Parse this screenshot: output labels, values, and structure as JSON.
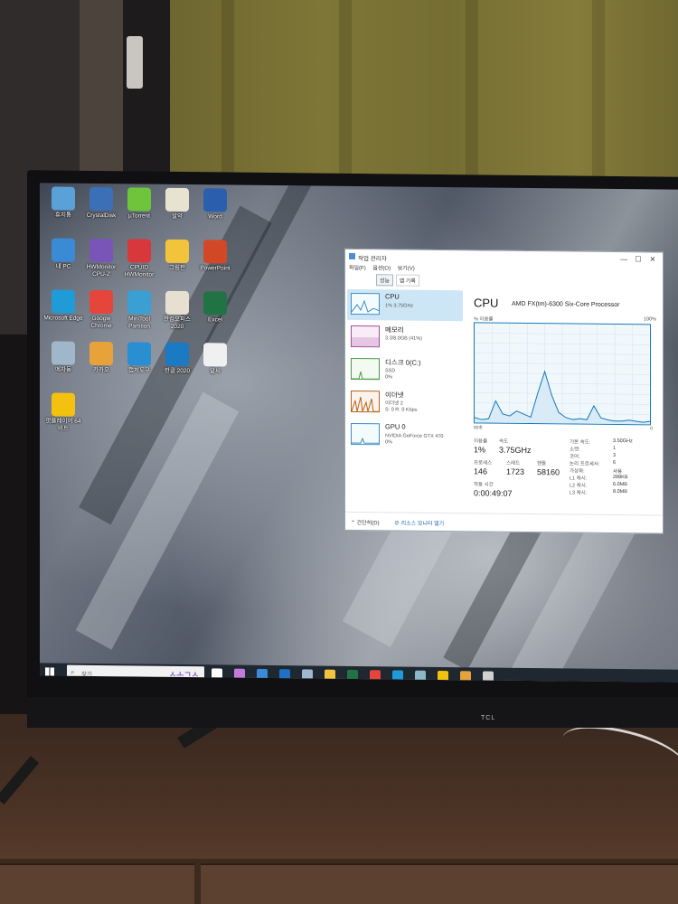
{
  "desktop": {
    "icons": [
      {
        "label": "휴지통",
        "color": "#5aa1d8"
      },
      {
        "label": "CrystalDisk",
        "color": "#3b6fb6"
      },
      {
        "label": "µTorrent",
        "color": "#6ec43a"
      },
      {
        "label": "알약",
        "color": "#e8e2d0"
      },
      {
        "label": "Word",
        "color": "#2b5fae"
      },
      {
        "label": "내 PC",
        "color": "#3a8ad6"
      },
      {
        "label": "HWMonitor CPU-Z",
        "color": "#7a55b8"
      },
      {
        "label": "CPUID HWMonitor",
        "color": "#d8383b"
      },
      {
        "label": "그림판",
        "color": "#f2c43c"
      },
      {
        "label": "PowerPoint",
        "color": "#d24726"
      },
      {
        "label": "Microsoft Edge",
        "color": "#1f9bd8"
      },
      {
        "label": "Google Chrome",
        "color": "#e5453a"
      },
      {
        "label": "MiniTool Partition",
        "color": "#3aa0d4"
      },
      {
        "label": "한컴오피스 2020",
        "color": "#e7e0d0"
      },
      {
        "label": "Excel",
        "color": "#217346"
      },
      {
        "label": "메자동",
        "color": "#9fb7c9"
      },
      {
        "label": "카카오",
        "color": "#e8a23a"
      },
      {
        "label": "캡처도구",
        "color": "#2a8fd0"
      },
      {
        "label": "한글 2020",
        "color": "#1b7ac4"
      },
      {
        "label": "알씨",
        "color": "#f0f0f0"
      },
      {
        "label": "팟플레이어 64 비트",
        "color": "#f4c10f"
      }
    ]
  },
  "task_manager": {
    "title": "작업 관리자",
    "window_buttons": {
      "minimize": "—",
      "maximize": "☐",
      "close": "✕"
    },
    "menu": [
      "파일(F)",
      "옵션(O)",
      "보기(V)"
    ],
    "tabs": [
      "성능",
      "앱 기록"
    ],
    "sidebar": [
      {
        "name": "CPU",
        "sub1": "1% 3.75GHz",
        "sub2": ""
      },
      {
        "name": "메모리",
        "sub1": "3.3/8.0GB (41%)",
        "sub2": ""
      },
      {
        "name": "디스크 0(C:)",
        "sub1": "SSD",
        "sub2": "0%"
      },
      {
        "name": "이더넷",
        "sub1": "이더넷 2",
        "sub2": "S: 0 R: 0 Kbps"
      },
      {
        "name": "GPU 0",
        "sub1": "NVIDIA GeForce GTX 470",
        "sub2": "0%"
      }
    ],
    "cpu": {
      "heading": "CPU",
      "model": "AMD FX(tm)-6300 Six-Core Processor",
      "util_label": "% 이용률",
      "util_max": "100%",
      "graph_left": "60초",
      "graph_right": "0",
      "utilization_series": [
        5,
        3,
        4,
        22,
        9,
        7,
        12,
        9,
        6,
        30,
        52,
        28,
        11,
        6,
        4,
        5,
        4,
        18,
        6,
        4,
        3,
        3,
        4,
        3,
        2,
        3
      ],
      "stats": {
        "usage_label": "이용률",
        "usage_value": "1%",
        "speed_label": "속도",
        "speed_value": "3.75GHz",
        "proc_label": "프로세스",
        "proc_value": "146",
        "threads_label": "스레드",
        "threads_value": "1723",
        "handles_label": "핸들",
        "handles_value": "58160",
        "uptime_label": "작동 시간",
        "uptime_value": "0:00:49:07"
      },
      "specs": [
        {
          "label": "기본 속도:",
          "value": "3.50GHz"
        },
        {
          "label": "소켓:",
          "value": "1"
        },
        {
          "label": "코어:",
          "value": "3"
        },
        {
          "label": "논리 프로세서:",
          "value": "6"
        },
        {
          "label": "가상화:",
          "value": "사용"
        },
        {
          "label": "L1 캐시:",
          "value": "288KB"
        },
        {
          "label": "L2 캐시:",
          "value": "6.0MB"
        },
        {
          "label": "L3 캐시:",
          "value": "8.0MB"
        }
      ]
    },
    "footer": {
      "less": "간단히(D)",
      "monitor": "리소스 모니터 열기"
    }
  },
  "taskbar": {
    "search_placeholder": "찾기",
    "search_art": "ㅅㅗㄱㅅ",
    "icons": [
      {
        "name": "task-view-icon",
        "color": "#ffffff"
      },
      {
        "name": "copilot-icon",
        "color": "#c47ad9"
      },
      {
        "name": "store-icon",
        "color": "#3a8ad6"
      },
      {
        "name": "outlook-icon",
        "color": "#1f6fc4"
      },
      {
        "name": "task-manager-icon",
        "color": "#9fb7d0"
      },
      {
        "name": "explorer-icon",
        "color": "#f2c43c"
      },
      {
        "name": "excel-icon",
        "color": "#217346"
      },
      {
        "name": "chrome-icon",
        "color": "#e5453a"
      },
      {
        "name": "edge-icon",
        "color": "#1f9bd8"
      },
      {
        "name": "network-icon",
        "color": "#8bb7c9"
      },
      {
        "name": "potplayer-icon",
        "color": "#f4c10f"
      },
      {
        "name": "files-icon",
        "color": "#e6a23c"
      },
      {
        "name": "settings-icon",
        "color": "#d0d0d0"
      }
    ]
  },
  "monitor": {
    "brand": "TCL"
  }
}
